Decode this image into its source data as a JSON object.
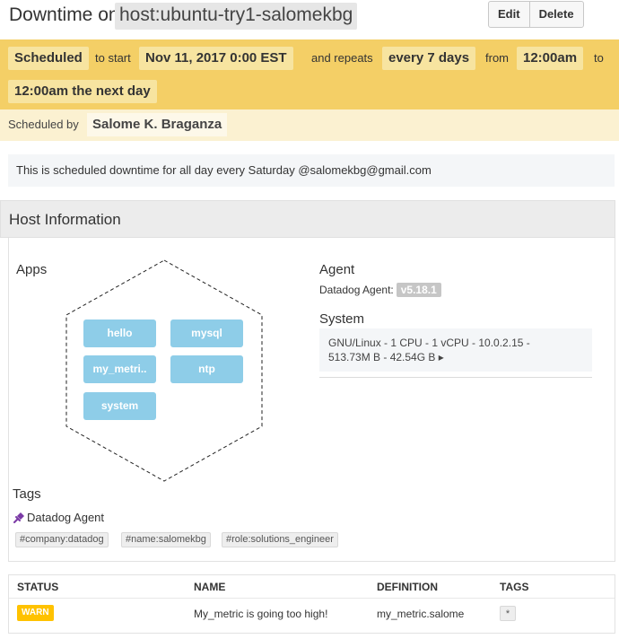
{
  "header": {
    "title_prefix": "Downtime on",
    "scope": "host:ubuntu-try1-salomekbg",
    "edit_label": "Edit",
    "delete_label": "Delete"
  },
  "schedule": {
    "status": "Scheduled",
    "to_start_text": "to start",
    "start": "Nov 11, 2017 0:00 EST",
    "repeats_text": "and repeats",
    "frequency": "every 7 days",
    "from_text": "from",
    "from_time": "12:00am",
    "to_text": "to",
    "to_time": "12:00am the next day"
  },
  "scheduled_by": {
    "label": "Scheduled by",
    "name": "Salome K. Braganza"
  },
  "message": "This is scheduled downtime for all day every Saturday @salomekbg@gmail.com",
  "host_info": {
    "heading": "Host Information",
    "apps_label": "Apps",
    "apps": [
      "hello",
      "mysql",
      "my_metri..",
      "ntp",
      "system"
    ],
    "agent_label": "Agent",
    "agent_name": "Datadog Agent:",
    "agent_version": "v5.18.1",
    "system_label": "System",
    "system_line1": "GNU/Linux - 1 CPU - 1 vCPU - 10.0.2.15 -",
    "system_line2": "513.73M B - 42.54G B ▸"
  },
  "tags": {
    "label": "Tags",
    "source": "Datadog Agent",
    "items": [
      "#company:datadog",
      "#name:salomekbg",
      "#role:solutions_engineer"
    ]
  },
  "monitors": {
    "columns": [
      "STATUS",
      "NAME",
      "DEFINITION",
      "TAGS"
    ],
    "rows": [
      {
        "status": "WARN",
        "name": "My_metric is going too high!",
        "definition": "my_metric.salome",
        "tags": "*"
      }
    ]
  },
  "colors": {
    "schedule_band": "#f4cf66",
    "app_tile": "#8ecde8",
    "warn": "#ffc200",
    "pin": "#7b3aa6"
  }
}
